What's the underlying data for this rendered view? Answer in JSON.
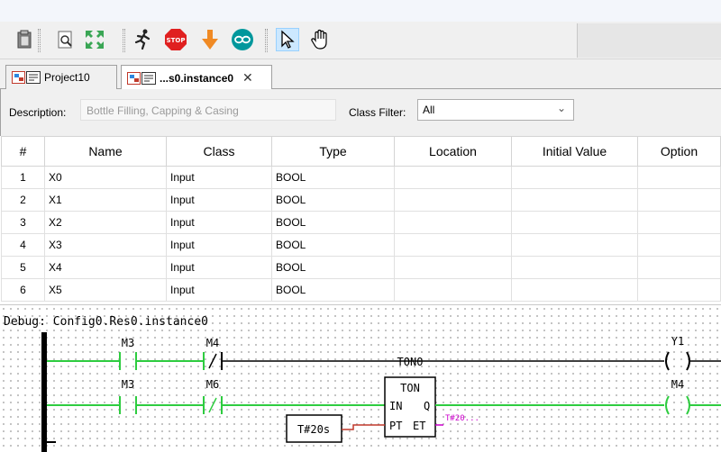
{
  "toolbar": {
    "icons": [
      "clipboard-icon",
      "print-preview-icon",
      "fullscreen-icon",
      "run-icon",
      "stop-icon",
      "download-icon",
      "arduino-icon",
      "pointer-icon",
      "hand-icon"
    ]
  },
  "tabs": [
    {
      "label": "Project10",
      "active": false
    },
    {
      "label": "...s0.instance0",
      "active": true,
      "close": "✕"
    }
  ],
  "description": {
    "label": "Description:",
    "value": "Bottle Filling, Capping & Casing"
  },
  "class_filter": {
    "label": "Class Filter:",
    "value": "All"
  },
  "table": {
    "headers": [
      "#",
      "Name",
      "Class",
      "Type",
      "Location",
      "Initial Value",
      "Option"
    ],
    "rows": [
      {
        "num": "1",
        "name": "X0",
        "cls": "Input",
        "type": "BOOL"
      },
      {
        "num": "2",
        "name": "X1",
        "cls": "Input",
        "type": "BOOL"
      },
      {
        "num": "3",
        "name": "X2",
        "cls": "Input",
        "type": "BOOL"
      },
      {
        "num": "4",
        "name": "X3",
        "cls": "Input",
        "type": "BOOL"
      },
      {
        "num": "5",
        "name": "X4",
        "cls": "Input",
        "type": "BOOL"
      },
      {
        "num": "6",
        "name": "X5",
        "cls": "Input",
        "type": "BOOL"
      }
    ]
  },
  "ladder": {
    "debug_label": "Debug: Config0.Res0.instance0",
    "rung1": {
      "contact_a": "M3",
      "contact_b": "M4",
      "block_instance": "TON0",
      "coil": "Y1"
    },
    "rung2": {
      "contact_a": "M3",
      "contact_b": "M6",
      "coil": "M4"
    },
    "block": {
      "type": "TON",
      "in": "IN",
      "q": "Q",
      "pt": "PT",
      "et": "ET"
    },
    "preset": "T#20s",
    "et_value": "T#20...",
    "colors": {
      "energized": "#2ecc40",
      "wire": "#000000",
      "preset_wire": "#c0392b",
      "debug_value": "#cc00cc"
    }
  }
}
